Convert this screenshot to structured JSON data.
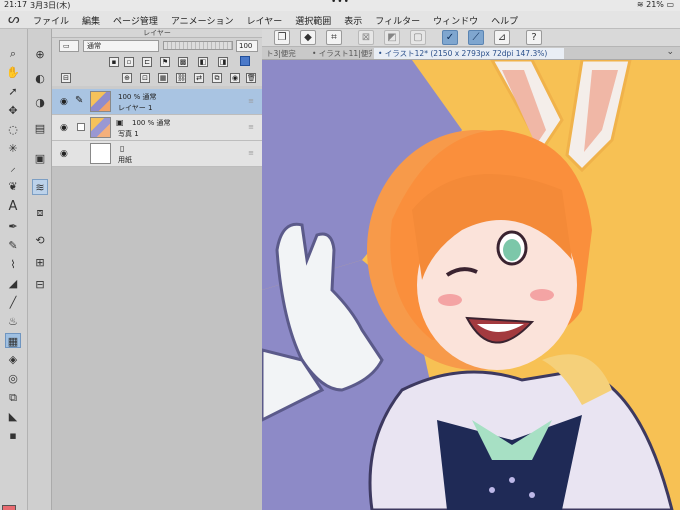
{
  "status": {
    "time": "21:17",
    "date": "3月3日(木)",
    "dots": "•••",
    "battery": "21%"
  },
  "menu": {
    "items": [
      "ファイル",
      "編集",
      "ページ管理",
      "アニメーション",
      "レイヤー",
      "選択範囲",
      "表示",
      "フィルター",
      "ウィンドウ",
      "ヘルプ"
    ]
  },
  "layer_panel": {
    "title": "レイヤー",
    "blend_mode": "通常",
    "opacity": "100"
  },
  "layers": [
    {
      "opacity_mode": "100 % 通常",
      "name": "レイヤー 1",
      "selected": true
    },
    {
      "opacity_mode": "100 % 通常",
      "name": "写真 1",
      "selected": false
    },
    {
      "opacity_mode": "",
      "name": "用紙",
      "selected": false
    }
  ],
  "tabs": [
    {
      "label": "ト3|便完",
      "active": false
    },
    {
      "label": "• イラスト11|便完",
      "active": false
    },
    {
      "label": "• イラスト12* (2150 x 2793px 72dpi 147.3%)",
      "active": true
    }
  ],
  "colors": {
    "main": "#e86a70",
    "sub": "#ffffff",
    "canvas_bg": "#f7c154",
    "purple": "#8d8ac7"
  }
}
